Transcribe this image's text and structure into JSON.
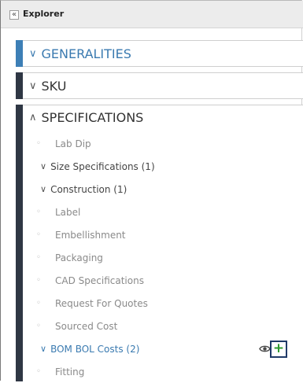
{
  "panel": {
    "title": "Explorer",
    "collapse_glyph": "«"
  },
  "sections": {
    "generalities": {
      "label": "GENERALITIES",
      "chevron": "∨",
      "accent": "#3d7fb6"
    },
    "sku": {
      "label": "SKU",
      "chevron": "∨",
      "accent": "#2f3744"
    },
    "specifications": {
      "label": "SPECIFICATIONS",
      "chevron": "∧",
      "accent": "#2f3744"
    }
  },
  "spec_items": [
    {
      "label": "Lab Dip"
    },
    {
      "label": "Size Specifications (1)",
      "toggle": "∨"
    },
    {
      "label": "Construction (1)",
      "toggle": "∨"
    },
    {
      "label": "Label"
    },
    {
      "label": "Embellishment"
    },
    {
      "label": "Packaging"
    },
    {
      "label": "CAD Specifications"
    },
    {
      "label": "Request For Quotes"
    },
    {
      "label": "Sourced Cost"
    },
    {
      "label": "BOM BOL Costs (2)",
      "toggle": "∨",
      "actions": {
        "view_icon": "eye-icon",
        "add_glyph": "+"
      }
    },
    {
      "label": "Fitting"
    }
  ],
  "bullet": "◦"
}
